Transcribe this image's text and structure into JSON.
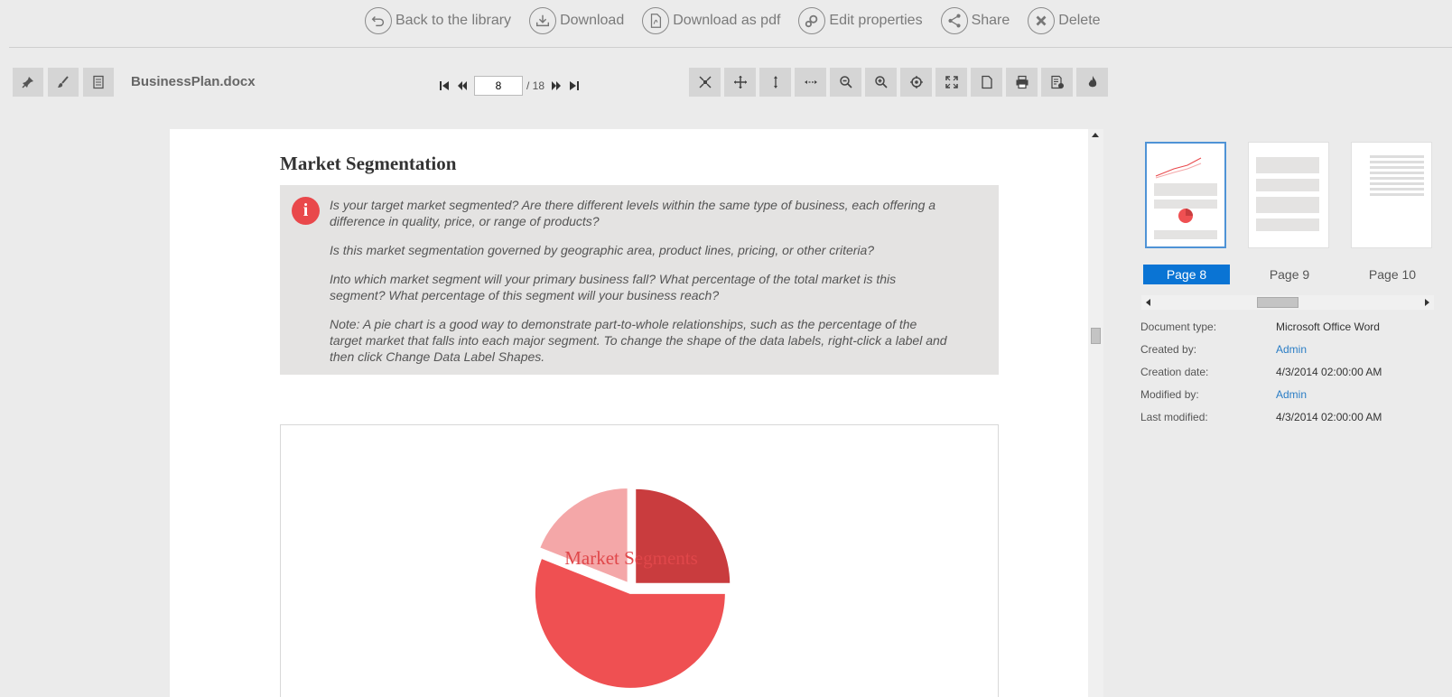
{
  "top_actions": [
    {
      "label": "Back to the library",
      "icon": "undo-icon"
    },
    {
      "label": "Download",
      "icon": "download-icon"
    },
    {
      "label": "Download as pdf",
      "icon": "pdf-icon"
    },
    {
      "label": "Edit properties",
      "icon": "gears-icon"
    },
    {
      "label": "Share",
      "icon": "share-icon"
    },
    {
      "label": "Delete",
      "icon": "delete-icon"
    }
  ],
  "toolbar": {
    "left_tools": [
      "pin-icon",
      "brush-icon",
      "document-icon"
    ],
    "filename": "BusinessPlan.docx",
    "pager": {
      "current_page": "8",
      "total": "/ 18"
    },
    "right_tools": [
      "fit-page-icon",
      "move-icon",
      "fit-height-icon",
      "fit-width-icon",
      "zoom-out-icon",
      "zoom-in-icon",
      "target-icon",
      "fullscreen-icon",
      "page-icon",
      "print-icon",
      "properties-icon",
      "fire-icon"
    ]
  },
  "document": {
    "heading": "Market Segmentation",
    "tips": [
      "Is your target market segmented? Are there different levels within the same type of business, each offering a difference in quality, price, or range of products?",
      "Is this market segmentation governed by geographic area, product lines, pricing, or other criteria?",
      "Into which market segment will your primary business fall? What percentage of the total market is this segment? What percentage of this segment will your business reach?",
      "Note: A pie chart is a good way to demonstrate part-to-whole relationships, such as the percentage of the target market that falls into each major segment. To change the shape of the data labels, right-click a label and then click Change Data Label Shapes."
    ]
  },
  "chart_data": {
    "type": "pie",
    "title": "Market Segments",
    "slices": [
      {
        "value": 25,
        "color": "#c93c3e"
      },
      {
        "value": 56,
        "color": "#ef5052"
      },
      {
        "value": 19,
        "color": "#f4a7a8"
      }
    ]
  },
  "thumbnails": [
    {
      "label": "Page 8",
      "selected": true
    },
    {
      "label": "Page 9",
      "selected": false
    },
    {
      "label": "Page 10",
      "selected": false
    }
  ],
  "properties": [
    {
      "key": "Document type:",
      "value": "Microsoft Office Word",
      "link": false
    },
    {
      "key": "Created by:",
      "value": "Admin",
      "link": true
    },
    {
      "key": "Creation date:",
      "value": "4/3/2014 02:00:00 AM",
      "link": false
    },
    {
      "key": "Modified by:",
      "value": "Admin",
      "link": true
    },
    {
      "key": "Last modified:",
      "value": "4/3/2014 02:00:00 AM",
      "link": false
    }
  ],
  "colors": {
    "accent": "#0a74d4",
    "alert": "#e9484b"
  }
}
